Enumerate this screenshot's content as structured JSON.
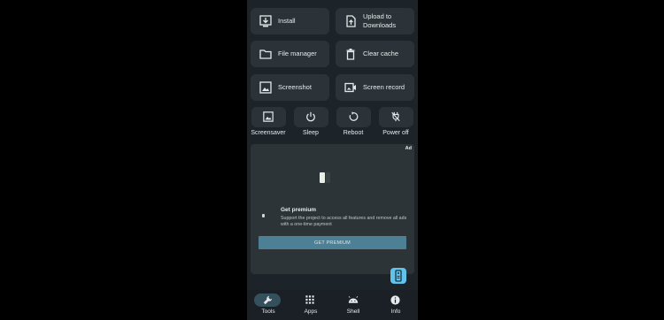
{
  "tiles": {
    "install": "Install",
    "upload_line1": "Upload to",
    "upload_line2": "Downloads",
    "file_manager": "File manager",
    "clear_cache": "Clear cache",
    "screenshot": "Screenshot",
    "screen_record": "Screen record"
  },
  "power_actions": {
    "screensaver": "Screensaver",
    "sleep": "Sleep",
    "reboot": "Reboot",
    "power_off": "Power off"
  },
  "ad": {
    "badge": "Ad",
    "title": "Get premium",
    "description": "Support the project to access all features and remove all ads with a one-time payment",
    "button": "GET PREMIUM"
  },
  "nav": {
    "tools": "Tools",
    "apps": "Apps",
    "shell": "Shell",
    "info": "Info",
    "active": "Tools"
  },
  "colors": {
    "background": "#1d2429",
    "tile": "#2b3338",
    "accent": "#4d7f95",
    "fab": "#5fc3ec",
    "active_pill": "#34505d"
  }
}
